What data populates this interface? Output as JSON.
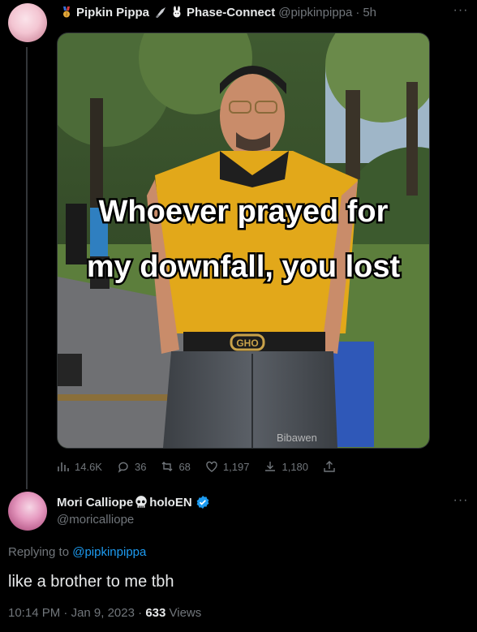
{
  "tweet": {
    "author_name": "Pipkin Pippa",
    "badges_icons": [
      "medal-icon",
      "knife-icon",
      "rabbit-icon"
    ],
    "affiliation": "Phase-Connect",
    "handle": "@pipkinpippa",
    "separator": "·",
    "time": "5h",
    "more_label": "···",
    "image": {
      "caption_line1": "Whoever prayed for",
      "caption_line2": "my downfall, you lost",
      "watermark": "Bibawen",
      "buckle_text": "GHO"
    },
    "stats": {
      "views": "14.6K",
      "replies": "36",
      "retweets": "68",
      "likes": "1,197",
      "bookmarks": "1,180"
    }
  },
  "reply": {
    "author_name": "Mori Calliope",
    "name_suffix": "holoEN",
    "handle": "@moricalliope",
    "more_label": "···",
    "replying_prefix": "Replying to ",
    "replying_to": "@pipkinpippa",
    "text": "like a brother to me tbh",
    "time": "10:14 PM",
    "date": "Jan 9, 2023",
    "separator": "·",
    "views_count": "633",
    "views_label": "Views"
  },
  "colors": {
    "background": "#000000",
    "text": "#e7e9ea",
    "muted": "#71767b",
    "link": "#1d9bf0",
    "verified": "#1d9bf0",
    "shirt": "#e2a81a"
  }
}
